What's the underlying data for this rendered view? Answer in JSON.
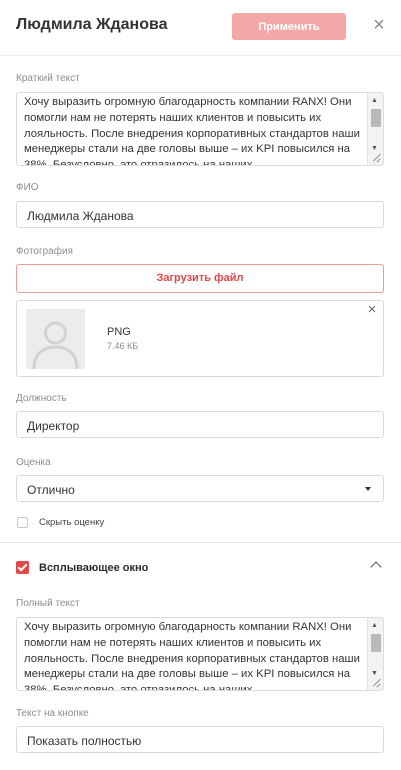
{
  "header": {
    "title": "Людмила Жданова",
    "apply_label": "Применить",
    "close_icon": "×"
  },
  "short_text": {
    "label": "Краткий текст",
    "value": "Хочу выразить огромную благодарность компании RANX! Они помогли нам не потерять наших клиентов и повысить их лояльность. После внедрения корпоративных стандартов наши менеджеры стали на две головы выше – их KPI повысился на 38%. Безусловно, это отразилось на наших"
  },
  "fio": {
    "label": "ФИО",
    "value": "Людмила Жданова"
  },
  "photo": {
    "label": "Фотография",
    "upload_label": "Загрузить файл",
    "file_type": "PNG",
    "file_size": "7.46 КБ",
    "remove_icon": "×"
  },
  "position": {
    "label": "Должность",
    "value": "Директор"
  },
  "rating": {
    "label": "Оценка",
    "value": "Отлично",
    "hide_label": "Скрыть оценку"
  },
  "popup": {
    "label": "Всплывающее окно",
    "full_text_label": "Полный текст",
    "full_text_value": "Хочу выразить огромную благодарность компании RANX! Они помогли нам не потерять наших клиентов и повысить их лояльность. После внедрения корпоративных стандартов наши менеджеры стали на две головы выше – их KPI повысился на 38%. Безусловно, это отразилось на наших",
    "button_text_label": "Текст на кнопке",
    "button_text_value": "Показать полностью"
  },
  "colors": {
    "accent": "#e04a4a",
    "accent_disabled": "#f4a7a7"
  }
}
